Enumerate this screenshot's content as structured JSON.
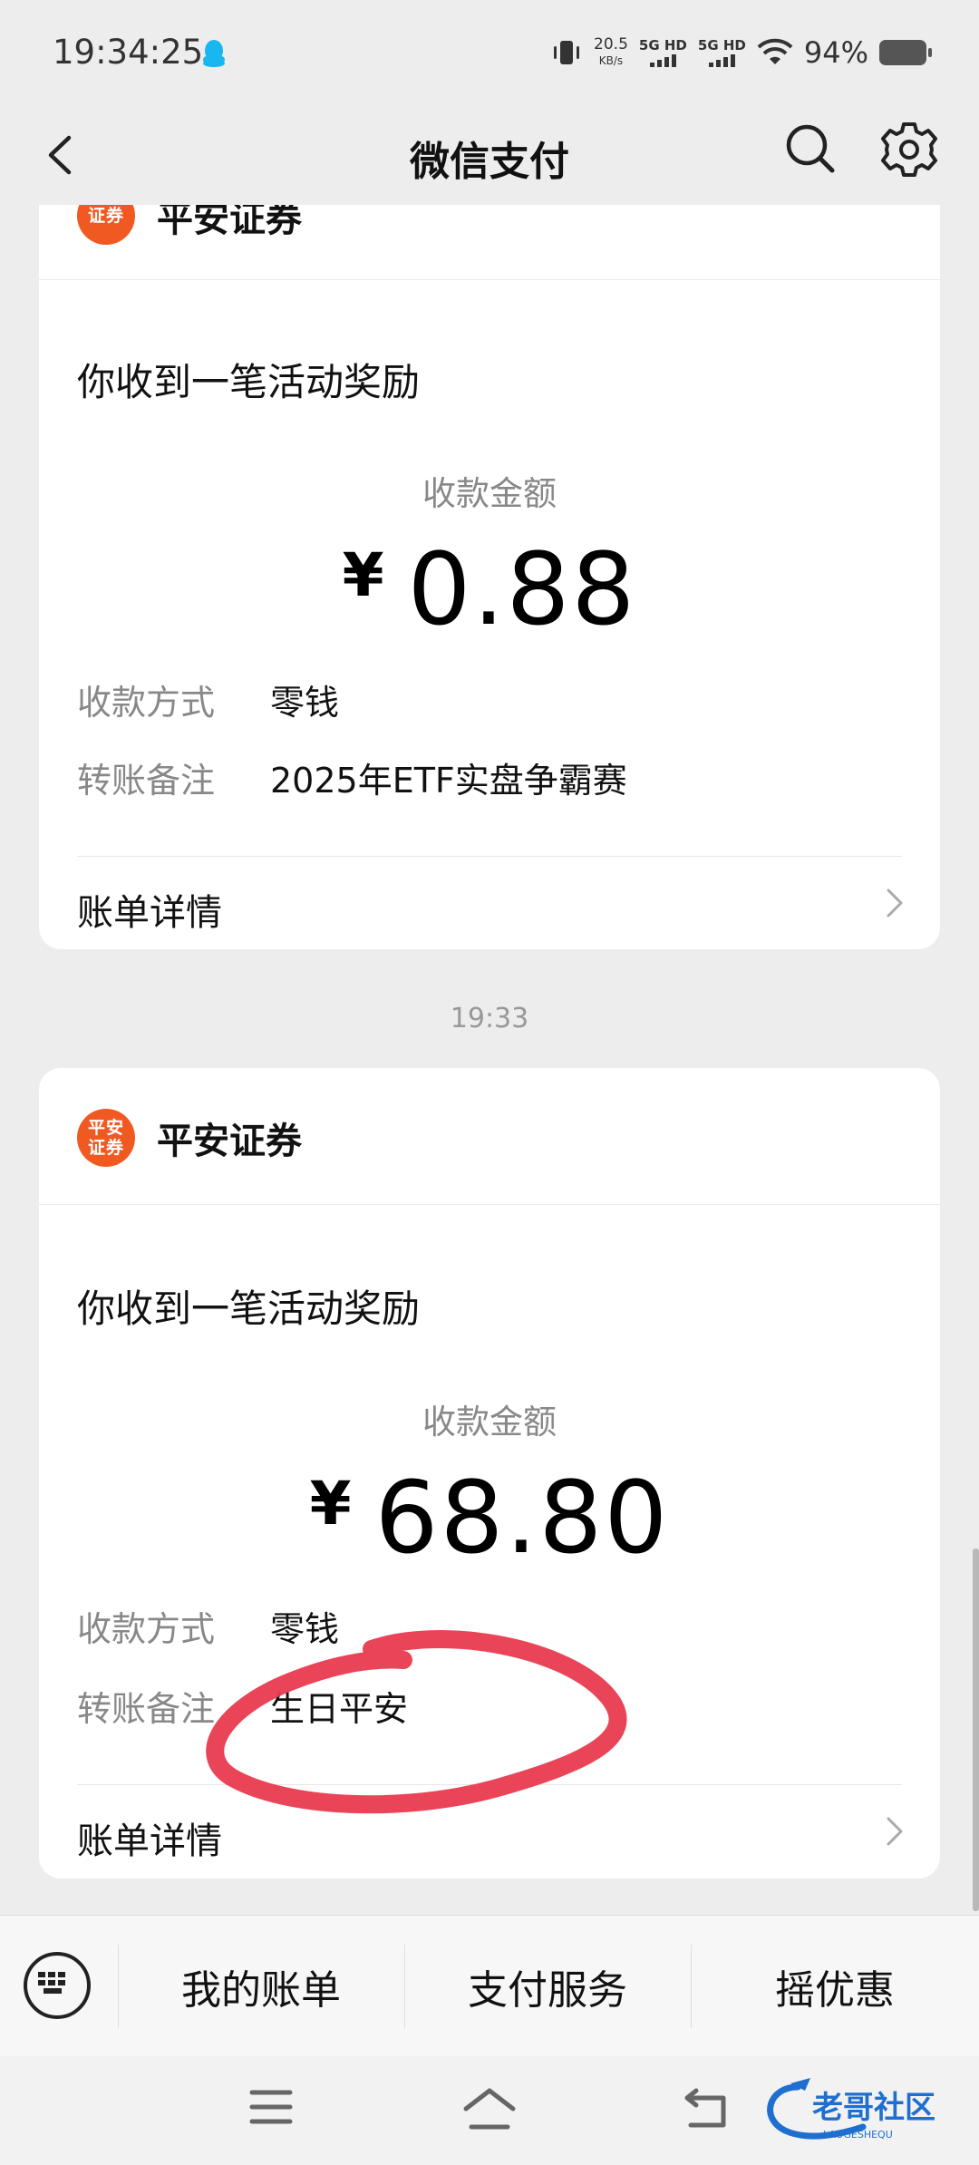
{
  "status": {
    "time": "19:34:25",
    "net_speed_value": "20.5",
    "net_speed_unit": "KB/s",
    "sim1": "5G HD",
    "sim2": "5G HD",
    "battery": "94%"
  },
  "nav": {
    "title": "微信支付"
  },
  "cards": [
    {
      "brand": "平安证券",
      "logo_text": "证券",
      "title": "你收到一笔活动奖励",
      "amount_label": "收款金额",
      "currency": "¥",
      "amount": "0.88",
      "method_label": "收款方式",
      "method_value": "零钱",
      "note_label": "转账备注",
      "note_value": "2025年ETF实盘争霸赛",
      "detail_label": "账单详情"
    },
    {
      "brand": "平安证券",
      "logo_line1": "平安",
      "logo_line2": "证券",
      "title": "你收到一笔活动奖励",
      "amount_label": "收款金额",
      "currency": "¥",
      "amount": "68.80",
      "method_label": "收款方式",
      "method_value": "零钱",
      "note_label": "转账备注",
      "note_value": "生日平安",
      "detail_label": "账单详情"
    }
  ],
  "timestamp": "19:33",
  "bottom_menu": [
    "我的账单",
    "支付服务",
    "摇优惠"
  ],
  "watermark": {
    "main": "老哥社区",
    "sub": "LAOGESHEQU"
  },
  "colors": {
    "brand_orange": "#f05a22",
    "highlight_red": "#e83a4e"
  }
}
